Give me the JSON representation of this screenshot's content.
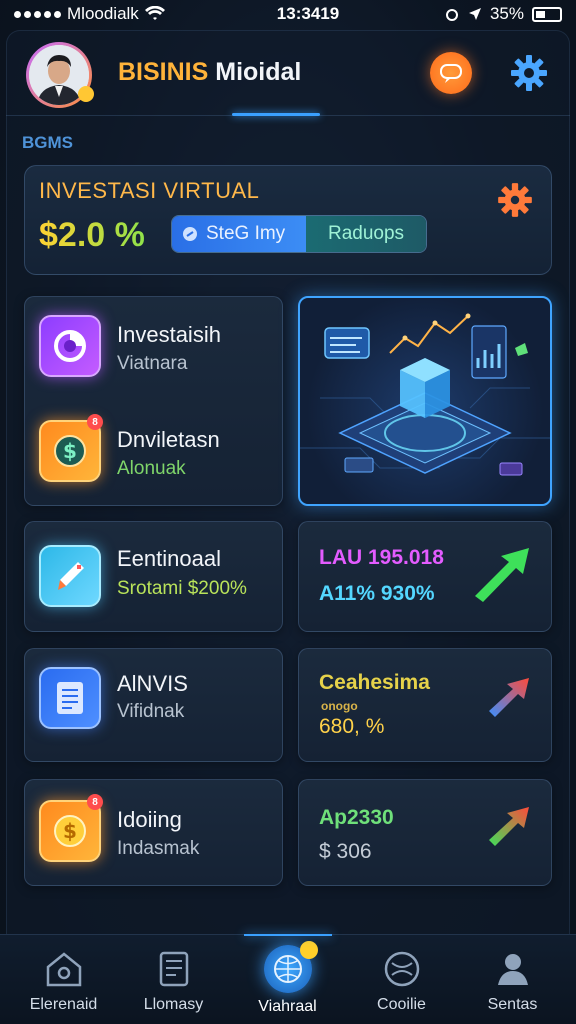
{
  "status_bar": {
    "carrier": "Mloodialk",
    "time": "13:3419",
    "battery": "35%"
  },
  "header": {
    "title_part1": "BISINIS",
    "title_part2": "Mioidal"
  },
  "section_label": "BGMS",
  "invest_card": {
    "title": "INVESTASI VIRTUAL",
    "value": "$2.0 %",
    "seg_a_label": "SteG Imy",
    "seg_b_label": "Raduops"
  },
  "menu_items": [
    {
      "title": "Investaisih",
      "subtitle": "Viatnara",
      "subtitle_color": "#b8c3d0"
    },
    {
      "title": "Dnviletasn",
      "subtitle": "Alonuak",
      "subtitle_color": "#7fd56a"
    },
    {
      "title": "Eentinoaal",
      "subtitle": "Srotami $200%",
      "subtitle_color": "#b9e35a"
    },
    {
      "title": "AlNVIS",
      "subtitle": "Vifidnak",
      "subtitle_color": "#b8c3d0"
    },
    {
      "title": "Idoiing",
      "subtitle": "Indasmak",
      "subtitle_color": "#b8c3d0"
    }
  ],
  "badges": {
    "dnviletasn": "8",
    "idoiing": "8"
  },
  "stats": [
    {
      "title": "LAU 195.018",
      "value": "A11% 930%",
      "color": "#e35cff",
      "value_color": "#54d7ff",
      "trend": "up"
    },
    {
      "title": "Ceahesima",
      "subtitle": "onogo",
      "value": "680, %",
      "color": "#e6d24a",
      "value_color": "#ffd24a",
      "trend": "up-right"
    },
    {
      "title": "Ap2330",
      "value": "$ 306",
      "color": "#6fe07a",
      "value_color": "#c4ccd6",
      "trend": "up-right"
    }
  ],
  "bottom_nav": [
    {
      "label": "Elerenaid",
      "icon": "home-icon"
    },
    {
      "label": "Llomasy",
      "icon": "document-icon"
    },
    {
      "label": "Viahraal",
      "icon": "globe-icon",
      "active": true
    },
    {
      "label": "Cooilie",
      "icon": "ball-icon"
    },
    {
      "label": "Sentas",
      "icon": "person-icon"
    }
  ],
  "colors": {
    "accent": "#3aa0ff",
    "brand_orange": "#ffb33a",
    "background": "#0c1522"
  }
}
